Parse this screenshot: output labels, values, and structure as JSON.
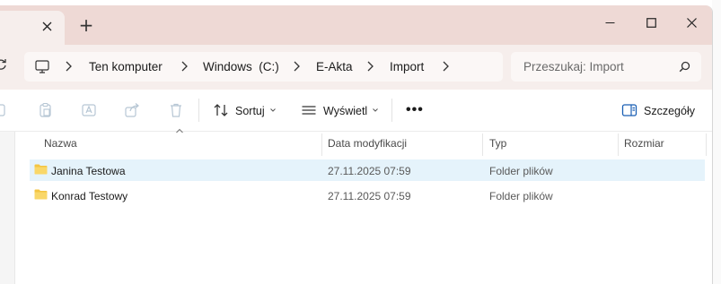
{
  "window": {
    "tab_close_glyph": "✕",
    "new_tab_glyph": "+"
  },
  "breadcrumb": {
    "items": [
      "Ten komputer",
      "Windows  (C:)",
      "E-Akta",
      "Import"
    ]
  },
  "search": {
    "placeholder": "Przeszukaj: Import"
  },
  "toolbar": {
    "sort_label": "Sortuj",
    "view_label": "Wyświetl",
    "more_label": "•••",
    "details_label": "Szczegóły"
  },
  "columns": {
    "name": "Nazwa",
    "modified": "Data modyfikacji",
    "type": "Typ",
    "size": "Rozmiar"
  },
  "files": [
    {
      "name": "Janina Testowa",
      "modified": "27.11.2025 07:59",
      "type": "Folder plików",
      "size": "",
      "selected": true
    },
    {
      "name": "Konrad Testowy",
      "modified": "27.11.2025 07:59",
      "type": "Folder plików",
      "size": "",
      "selected": false
    }
  ],
  "colors": {
    "titlebar": "#eed9d5",
    "addressbar": "#f6eeec",
    "selection": "#e5f3fb",
    "folder": "#f4c542"
  },
  "icons": [
    "monitor-icon",
    "search-icon",
    "folder-icon",
    "sort-icon",
    "view-icon",
    "details-pane-icon"
  ]
}
